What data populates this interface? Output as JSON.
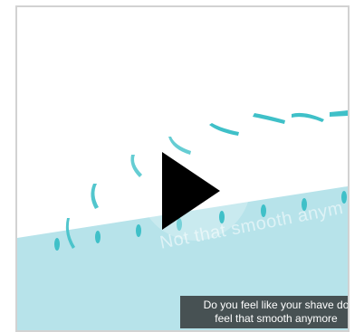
{
  "video": {
    "overlay_text": "Not that smooth anym",
    "caption_line1": "Do you feel like your shave do",
    "caption_line2": "feel that smooth anymore",
    "colors": {
      "background_top": "#ffffff",
      "water": "#b7e3ea",
      "stroke": "#3fc0c8",
      "frame_border": "#d2d2d2",
      "caption_bg": "#2b2b2b"
    },
    "controls": {
      "play_icon": "play-icon"
    }
  }
}
